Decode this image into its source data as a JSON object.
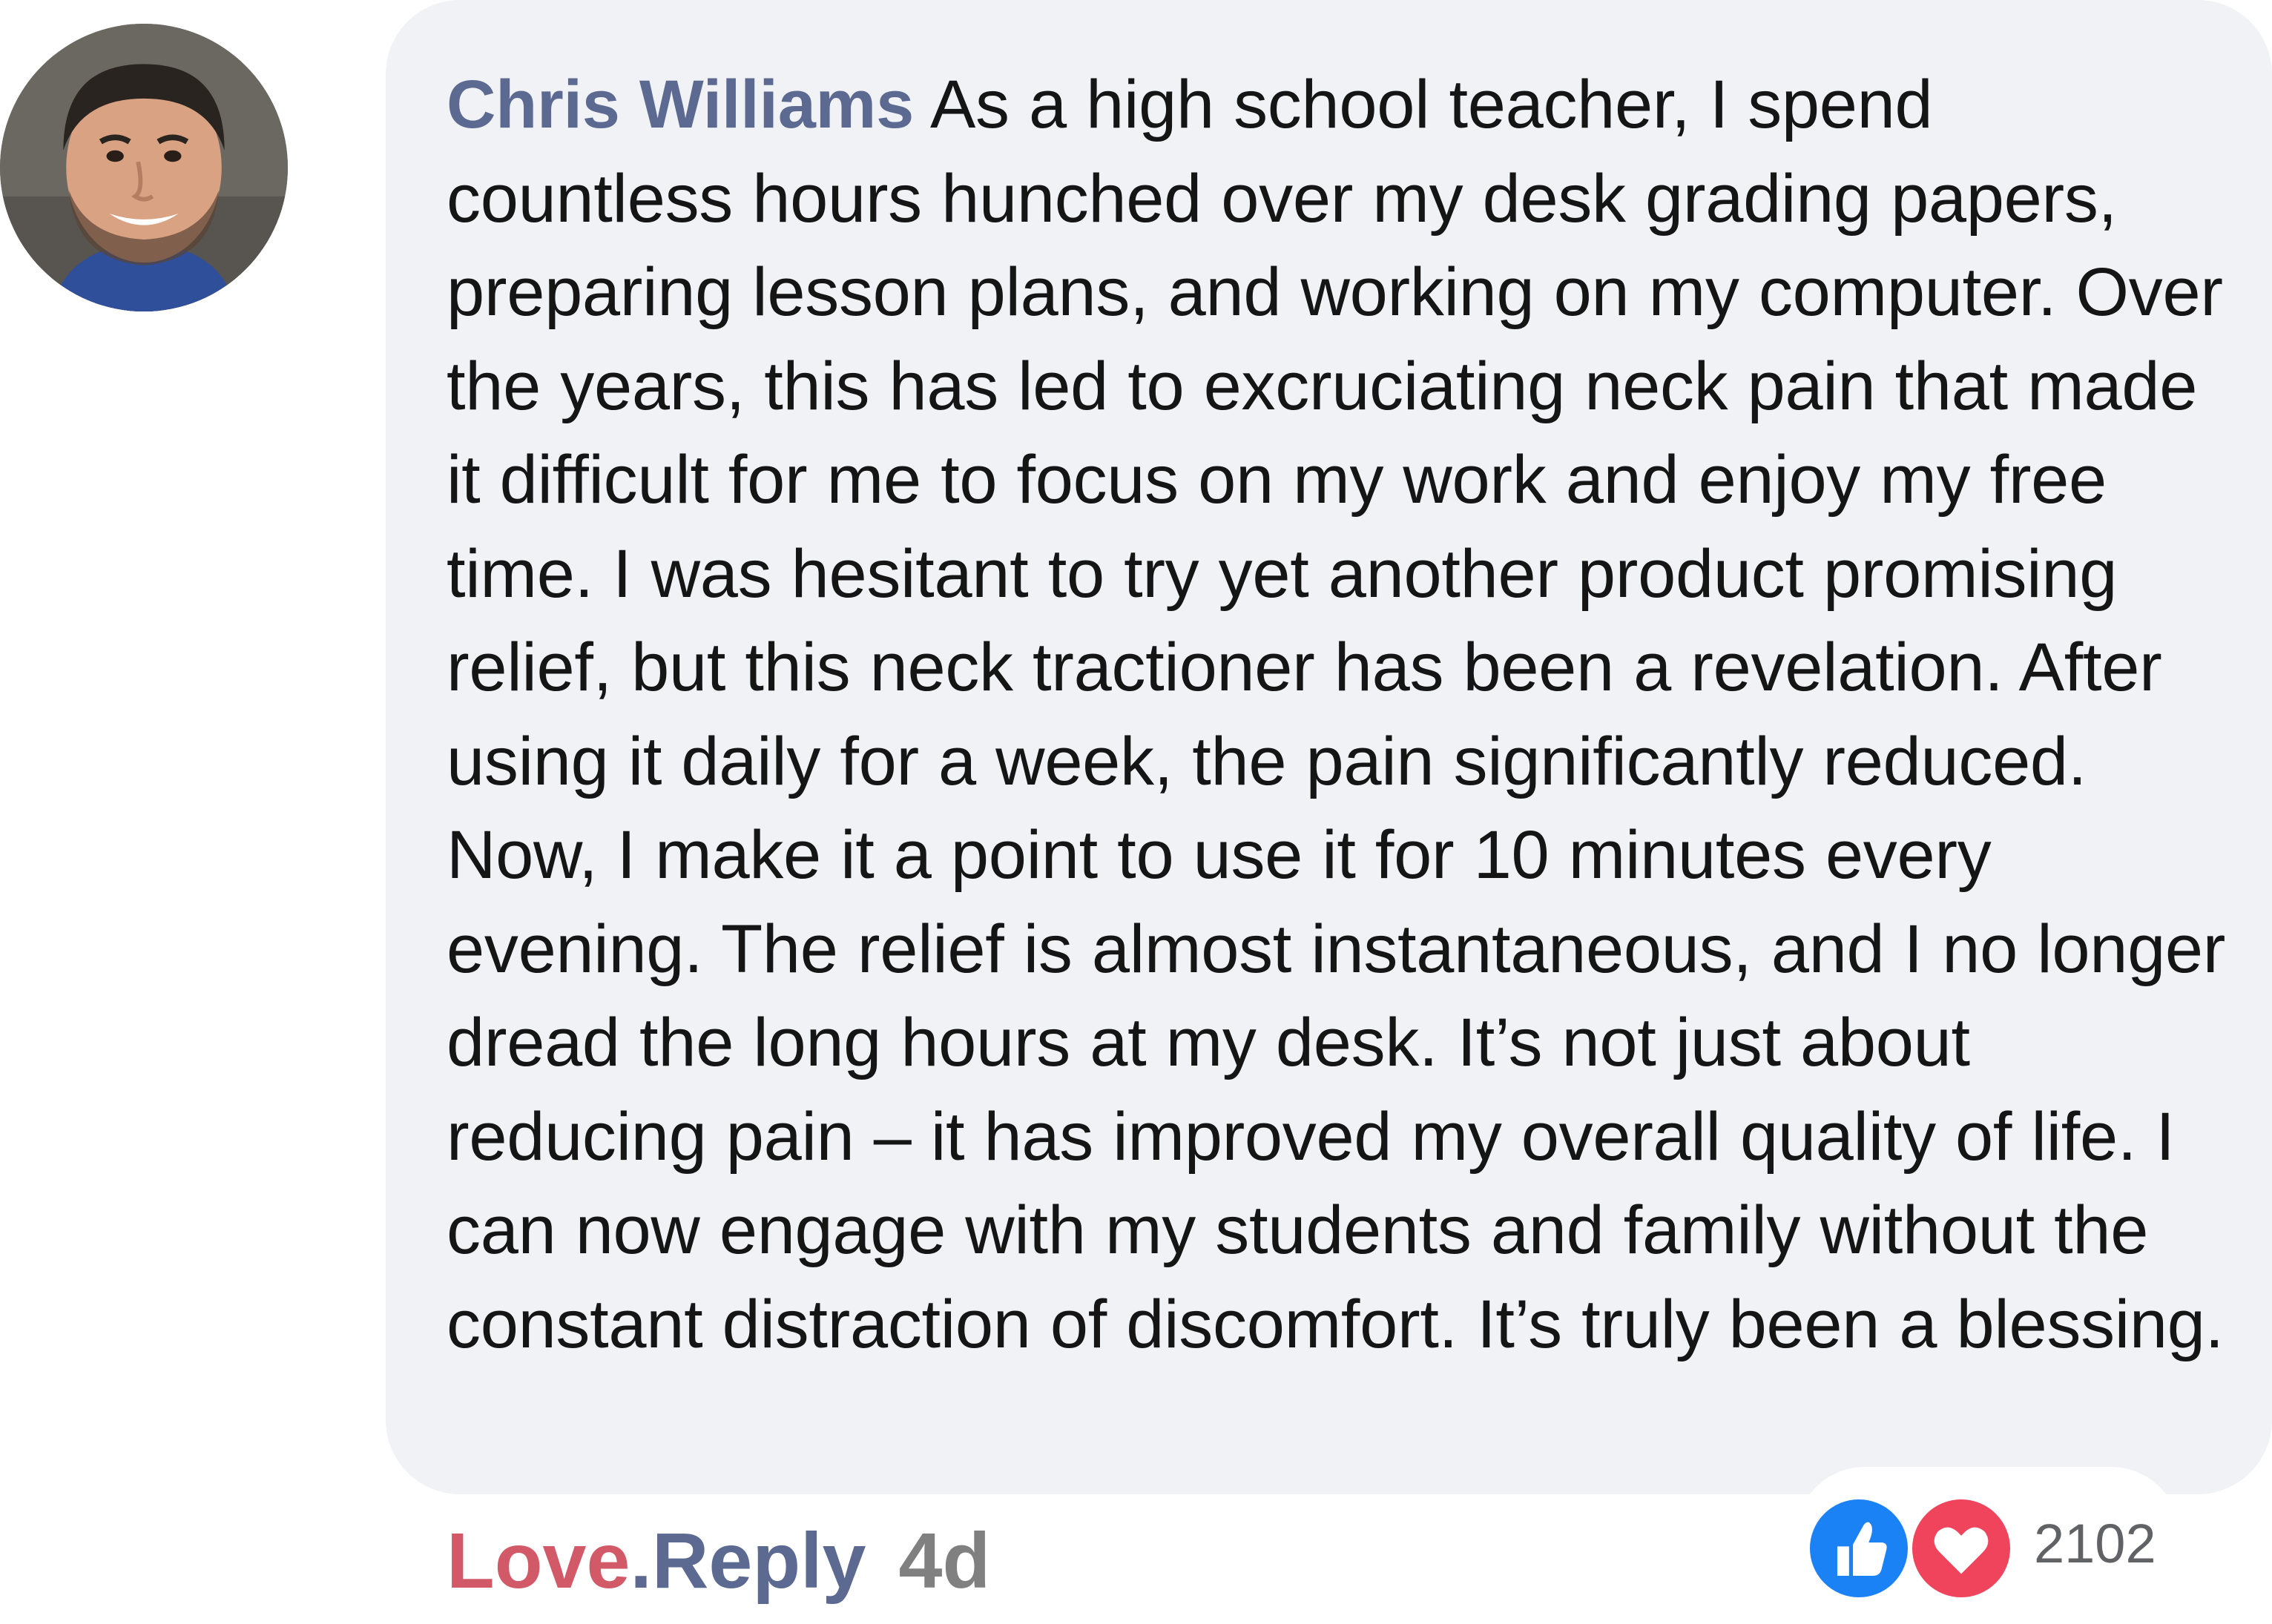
{
  "comment": {
    "author": "Chris Williams",
    "text": "As a high school teacher, I spend countless hours hunched over my desk grading papers, preparing lesson plans, and working on my computer. Over the years, this has led to excruciating neck pain that made it difficult for me to focus on my work and enjoy my free time. I was hesitant to try yet another product promising relief, but this neck tractioner has been a revelation. After using it daily for a week, the pain significantly reduced. Now, I make it a point to use it for 10 minutes every evening. The relief is almost instantaneous, and I no longer dread the long hours at my desk. It’s not just about reducing pain – it has improved my overall quality of life. I can now engage with my students and family without the constant distraction of discomfort. It’s truly been a blessing."
  },
  "actions": {
    "love_label": "Love",
    "reply_label": ".Reply",
    "time_ago": "4d"
  },
  "reactions": {
    "icons": [
      "like-icon",
      "heart-icon"
    ],
    "count": "2102"
  },
  "colors": {
    "author": "#5c6a92",
    "love": "#d25a68",
    "like_blue": "#1b82f5",
    "heart_red": "#f0445c",
    "bubble_bg": "#f1f2f6"
  }
}
